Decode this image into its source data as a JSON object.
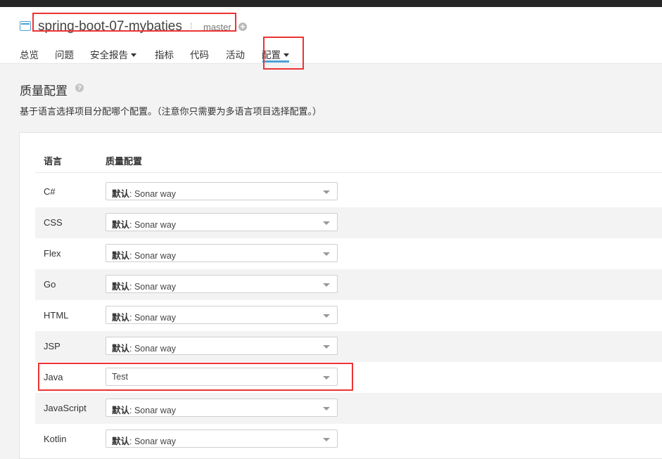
{
  "project": {
    "name": "spring-boot-07-mybaties",
    "branch": "master"
  },
  "nav": {
    "overview": "总览",
    "issues": "问题",
    "security_reports": "安全报告",
    "measures": "指标",
    "code": "代码",
    "activity": "活动",
    "administration": "配置"
  },
  "page": {
    "title": "质量配置",
    "description": "基于语言选择项目分配哪个配置。（注意你只需要为多语言项目选择配置。）"
  },
  "table": {
    "headers": {
      "language": "语言",
      "profile": "质量配置"
    },
    "rows": [
      {
        "language": "C#",
        "prefix": "默认",
        "profile": ": Sonar way"
      },
      {
        "language": "CSS",
        "prefix": "默认",
        "profile": ": Sonar way"
      },
      {
        "language": "Flex",
        "prefix": "默认",
        "profile": ": Sonar way"
      },
      {
        "language": "Go",
        "prefix": "默认",
        "profile": ": Sonar way"
      },
      {
        "language": "HTML",
        "prefix": "默认",
        "profile": ": Sonar way"
      },
      {
        "language": "JSP",
        "prefix": "默认",
        "profile": ": Sonar way"
      },
      {
        "language": "Java",
        "prefix": "",
        "profile": "Test"
      },
      {
        "language": "JavaScript",
        "prefix": "默认",
        "profile": ": Sonar way"
      },
      {
        "language": "Kotlin",
        "prefix": "默认",
        "profile": ": Sonar way"
      }
    ]
  },
  "colors": {
    "accent": "#4b9fd5",
    "highlight": "#e33333"
  }
}
